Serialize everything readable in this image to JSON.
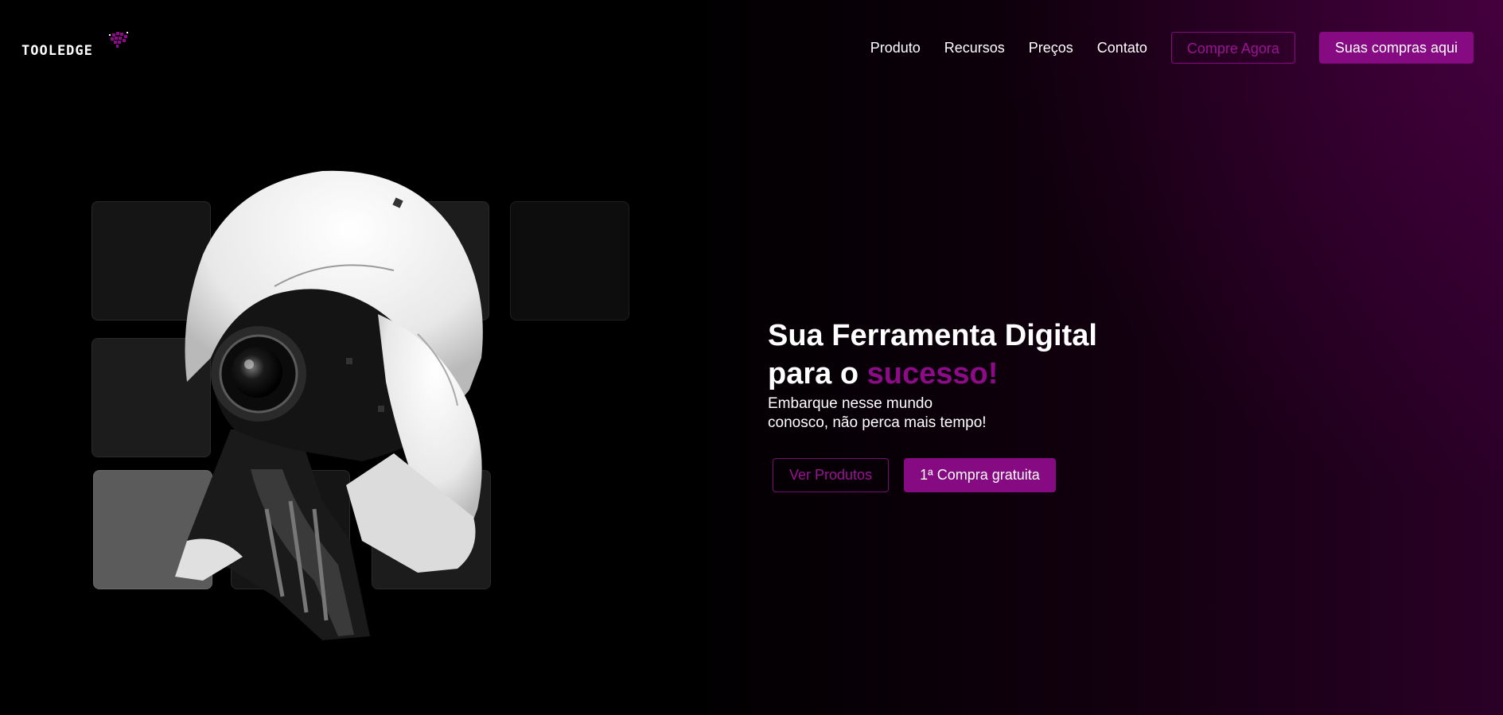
{
  "brand": {
    "name": "TOOLEDGE",
    "accent_color": "#860a81"
  },
  "nav": {
    "links": [
      "Produto",
      "Recursos",
      "Preços",
      "Contato"
    ],
    "cta_outline": "Compre Agora",
    "cta_solid": "Suas compras aqui"
  },
  "hero": {
    "title_line1": "Sua Ferramenta Digital",
    "title_line2_prefix": "para o ",
    "title_line2_accent": "sucesso!",
    "subtitle_line1": "Embarque nesse mundo",
    "subtitle_line2": "conosco, não perca mais tempo!",
    "btn_outline": "Ver Produtos",
    "btn_solid": "1ª Compra gratuita"
  }
}
